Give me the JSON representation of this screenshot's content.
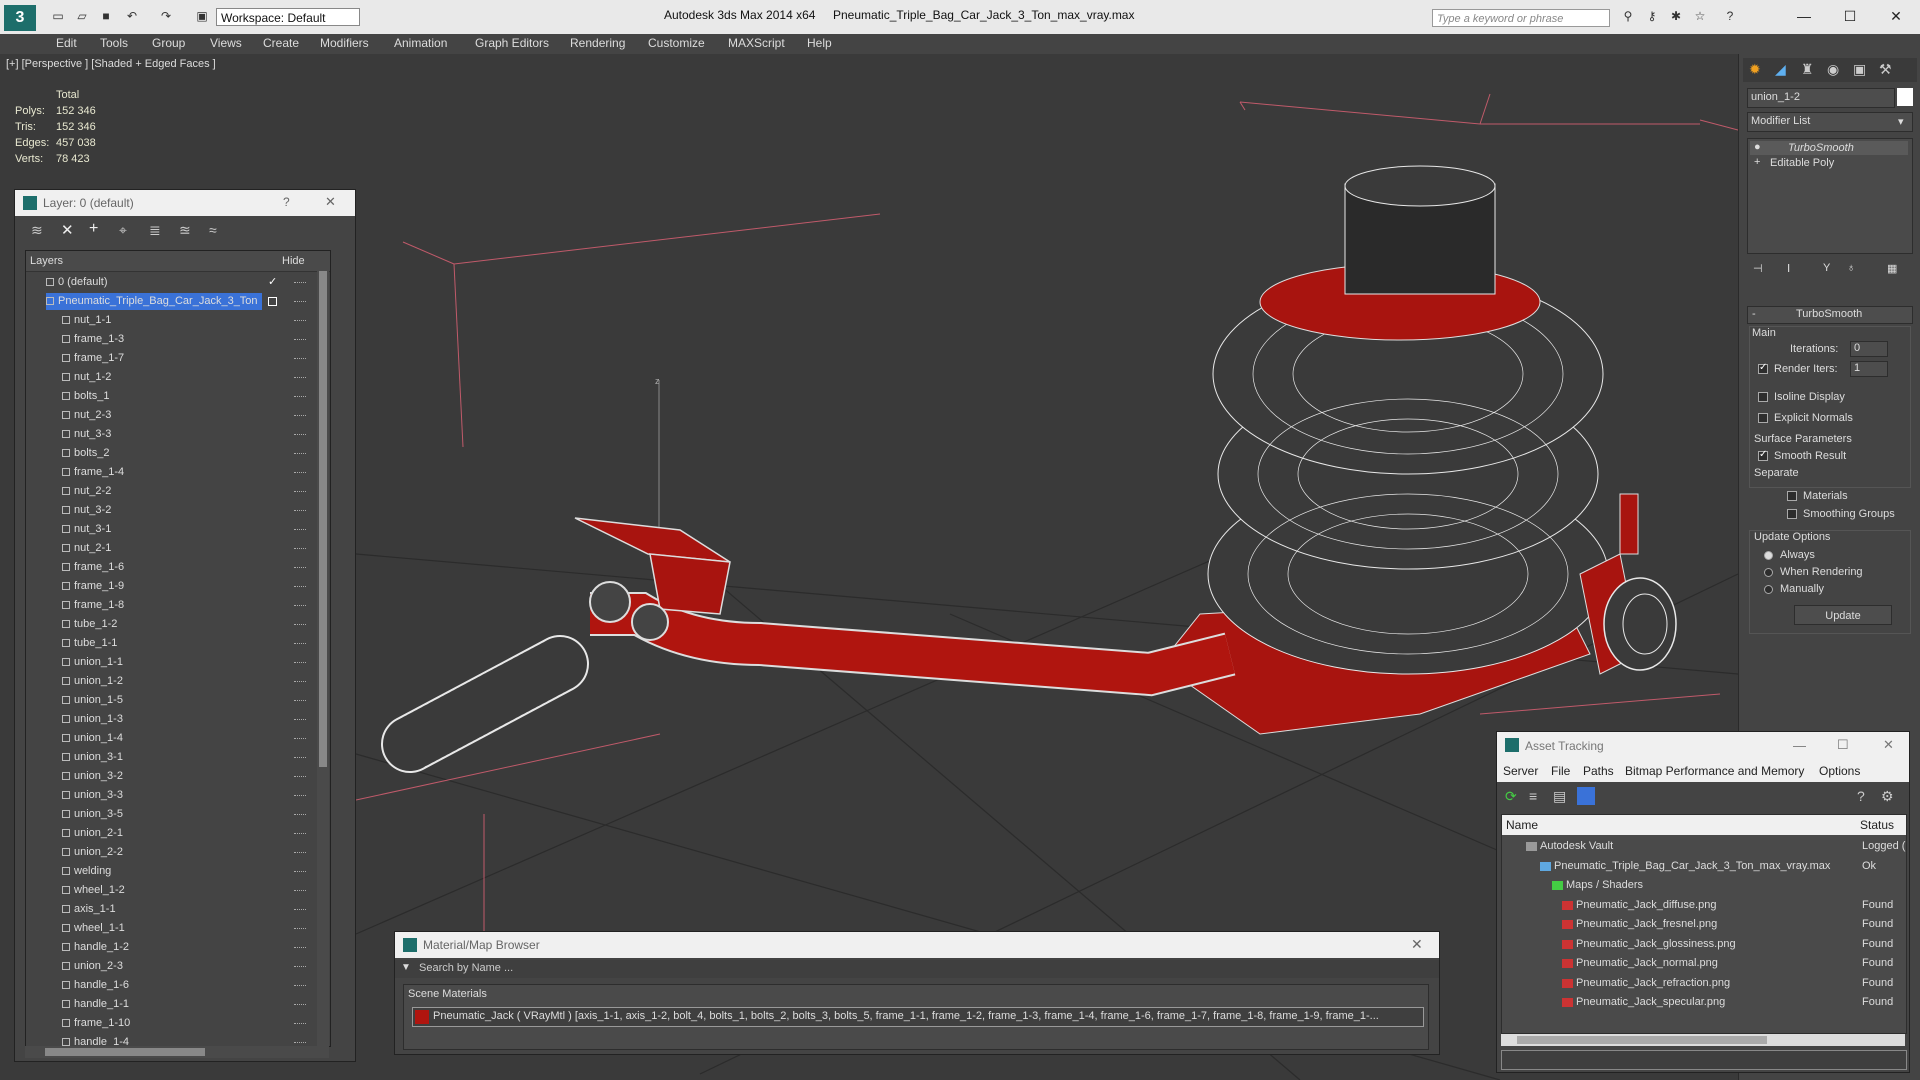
{
  "titlebar": {
    "app_title": "Autodesk 3ds Max  2014 x64",
    "file_name": "Pneumatic_Triple_Bag_Car_Jack_3_Ton_max_vray.max",
    "workspace": "Workspace: Default",
    "search_placeholder": "Type a keyword or phrase",
    "minimize": "—",
    "maximize": "☐",
    "close": "✕"
  },
  "menus": [
    "Edit",
    "Tools",
    "Group",
    "Views",
    "Create",
    "Modifiers",
    "Animation",
    "Graph Editors",
    "Rendering",
    "Customize",
    "MAXScript",
    "Help"
  ],
  "viewport": {
    "label": "[+] [Perspective ] [Shaded + Edged Faces ]",
    "stats_header": "Total",
    "stats": [
      {
        "label": "Polys:",
        "value": "152 346"
      },
      {
        "label": "Tris:",
        "value": "152 346"
      },
      {
        "label": "Edges:",
        "value": "457 038"
      },
      {
        "label": "Verts:",
        "value": "78 423"
      }
    ],
    "axis_label": "z"
  },
  "layer_window": {
    "title": "Layer: 0 (default)",
    "help": "?",
    "close": "✕",
    "col_layers": "Layers",
    "col_hide": "Hide",
    "default_layer": "0 (default)",
    "selected_layer": "Pneumatic_Triple_Bag_Car_Jack_3_Ton",
    "items": [
      "nut_1-1",
      "frame_1-3",
      "frame_1-7",
      "nut_1-2",
      "bolts_1",
      "nut_2-3",
      "nut_3-3",
      "bolts_2",
      "frame_1-4",
      "nut_2-2",
      "nut_3-2",
      "nut_3-1",
      "nut_2-1",
      "frame_1-6",
      "frame_1-9",
      "frame_1-8",
      "tube_1-2",
      "tube_1-1",
      "union_1-1",
      "union_1-2",
      "union_1-5",
      "union_1-3",
      "union_1-4",
      "union_3-1",
      "union_3-2",
      "union_3-3",
      "union_3-5",
      "union_2-1",
      "union_2-2",
      "welding",
      "wheel_1-2",
      "axis_1-1",
      "wheel_1-1",
      "handle_1-2",
      "union_2-3",
      "handle_1-6",
      "handle_1-1",
      "frame_1-10",
      "handle_1-4"
    ]
  },
  "command_panel": {
    "object_name": "union_1-2",
    "modifier_list": "Modifier List",
    "stack": [
      "TurboSmooth",
      "Editable Poly"
    ],
    "rollout_title": "TurboSmooth",
    "main_label": "Main",
    "iterations_label": "Iterations:",
    "iterations_value": "0",
    "render_iters_label": "Render Iters:",
    "render_iters_value": "1",
    "isoline": "Isoline Display",
    "explicit": "Explicit Normals",
    "surface_params": "Surface Parameters",
    "smooth_result": "Smooth Result",
    "separate": "Separate",
    "materials": "Materials",
    "smoothing_groups": "Smoothing Groups",
    "update_options": "Update Options",
    "always": "Always",
    "when_rendering": "When Rendering",
    "manually": "Manually",
    "update_button": "Update"
  },
  "material_browser": {
    "title": "Material/Map Browser",
    "close": "✕",
    "search_placeholder": "Search by Name ...",
    "section": "Scene Materials",
    "material_entry": "Pneumatic_Jack  ( VRayMtl )  [axis_1-1, axis_1-2, bolt_4, bolts_1, bolts_2, bolts_3, bolts_5, frame_1-1, frame_1-2, frame_1-3, frame_1-4, frame_1-6, frame_1-7, frame_1-8, frame_1-9, frame_1-..."
  },
  "asset_tracking": {
    "title": "Asset Tracking",
    "menu": [
      "Server",
      "File",
      "Paths",
      "Bitmap Performance and Memory",
      "Options"
    ],
    "col_name": "Name",
    "col_status": "Status",
    "rows": [
      {
        "name": "Autodesk Vault",
        "status": "Logged (",
        "indent": 0
      },
      {
        "name": "Pneumatic_Triple_Bag_Car_Jack_3_Ton_max_vray.max",
        "status": "Ok",
        "indent": 1
      },
      {
        "name": "Maps / Shaders",
        "status": "",
        "indent": 2
      },
      {
        "name": "Pneumatic_Jack_diffuse.png",
        "status": "Found",
        "indent": 3
      },
      {
        "name": "Pneumatic_Jack_fresnel.png",
        "status": "Found",
        "indent": 3
      },
      {
        "name": "Pneumatic_Jack_glossiness.png",
        "status": "Found",
        "indent": 3
      },
      {
        "name": "Pneumatic_Jack_normal.png",
        "status": "Found",
        "indent": 3
      },
      {
        "name": "Pneumatic_Jack_refraction.png",
        "status": "Found",
        "indent": 3
      },
      {
        "name": "Pneumatic_Jack_specular.png",
        "status": "Found",
        "indent": 3
      }
    ]
  },
  "colors": {
    "selection": "#3a72d8",
    "model_red": "#b0150f",
    "wire_white": "#e8e8e8"
  }
}
